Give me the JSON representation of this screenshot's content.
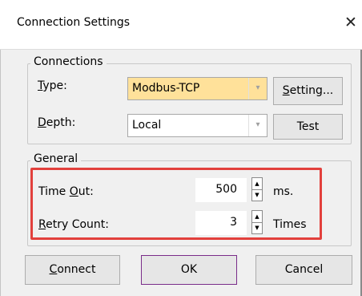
{
  "window": {
    "title": "Connection Settings",
    "close_glyph": "✕"
  },
  "connections": {
    "legend": "Connections",
    "type_label_mnemonic": "T",
    "type_label_rest": "ype:",
    "type_value": "Modbus-TCP",
    "depth_label_mnemonic": "D",
    "depth_label_rest": "epth:",
    "depth_value": "Local",
    "setting_button_mnemonic": "S",
    "setting_button_rest": "etting...",
    "test_button": "Test",
    "dropdown_glyph": "▾"
  },
  "general": {
    "legend": "General",
    "timeout_label_before": "Time ",
    "timeout_label_mnemonic": "O",
    "timeout_label_after": "ut:",
    "timeout_value": "500",
    "timeout_unit": "ms.",
    "retry_label_mnemonic": "R",
    "retry_label_rest": "etry Count:",
    "retry_value": "3",
    "retry_unit": "Times",
    "spin_up_glyph": "▲",
    "spin_down_glyph": "▼"
  },
  "buttons": {
    "connect_mnemonic": "C",
    "connect_rest": "onnect",
    "ok": "OK",
    "cancel": "Cancel"
  },
  "colors": {
    "highlight": "#e2403c",
    "active_combo": "#ffe19a",
    "default_button_border": "#7a2d8a"
  }
}
